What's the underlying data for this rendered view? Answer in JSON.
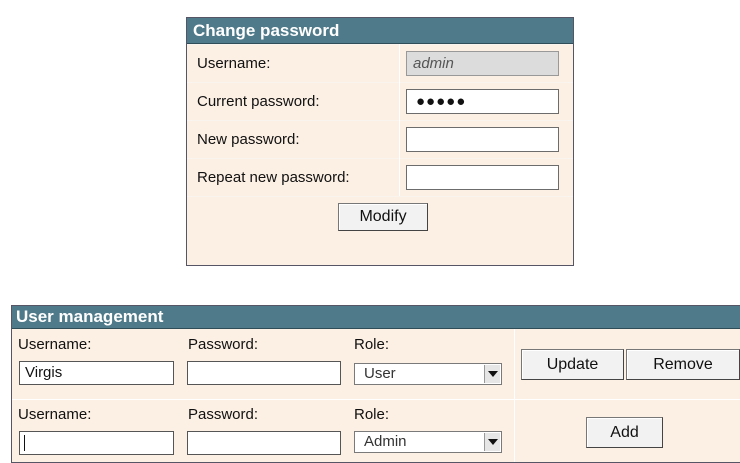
{
  "change_password": {
    "title": "Change password",
    "username_label": "Username:",
    "username_value": "admin",
    "current_password_label": "Current password:",
    "current_password_mask": "●●●●●",
    "new_password_label": "New password:",
    "new_password_value": "",
    "repeat_password_label": "Repeat new password:",
    "repeat_password_value": "",
    "modify_button": "Modify"
  },
  "user_management": {
    "title": "User management",
    "rows": [
      {
        "username_label": "Username:",
        "username_value": "Virgis",
        "password_label": "Password:",
        "password_value": "",
        "role_label": "Role:",
        "role_value": "User",
        "update_button": "Update",
        "remove_button": "Remove"
      },
      {
        "username_label": "Username:",
        "username_value": "",
        "password_label": "Password:",
        "password_value": "",
        "role_label": "Role:",
        "role_value": "Admin",
        "add_button": "Add"
      }
    ]
  },
  "colors": {
    "header_bg": "#4f7a8a",
    "panel_bg": "#fcefe3"
  }
}
